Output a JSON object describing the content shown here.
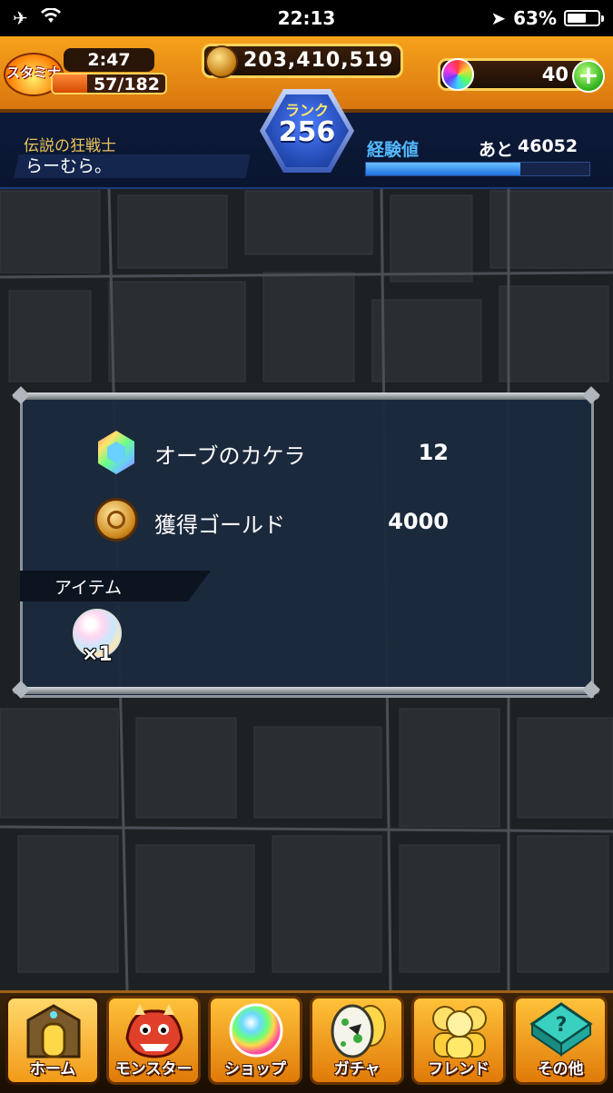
{
  "status_bar": {
    "time": "22:13",
    "battery_percent": "63%",
    "battery_level": 0.63,
    "icons": [
      "airplane-icon",
      "wifi-icon",
      "location-arrow-icon",
      "battery-icon"
    ]
  },
  "hud": {
    "stamina_label": "スタミナ",
    "stamina_timer": "2:47",
    "stamina_current": "57/182",
    "stamina_fraction": 0.31,
    "gold": "203,410,519",
    "orbs": "40",
    "rank_label": "ランク",
    "rank": "256",
    "player_title": "伝説の狂戦士",
    "player_name": "らーむら。",
    "exp_label": "経験値",
    "exp_remaining_prefix": "あと",
    "exp_remaining": "46052",
    "exp_fraction": 0.69
  },
  "result_dialog": {
    "rows": [
      {
        "icon": "orb-fragment-icon",
        "label": "オーブのカケラ",
        "value": "12"
      },
      {
        "icon": "gold-coin-icon",
        "label": "獲得ゴールド",
        "value": "4000"
      }
    ],
    "items_header": "アイテム",
    "items": [
      {
        "icon": "rainbow-orb-item-icon",
        "count": "×1"
      }
    ]
  },
  "bottom_nav": [
    {
      "id": "home",
      "label": "ホーム",
      "icon": "home-gate-icon",
      "active": true
    },
    {
      "id": "monster",
      "label": "モンスター",
      "icon": "monster-dragon-icon",
      "active": false
    },
    {
      "id": "shop",
      "label": "ショップ",
      "icon": "rainbow-orb-icon",
      "active": false
    },
    {
      "id": "gacha",
      "label": "ガチャ",
      "icon": "gacha-egg-icon",
      "active": false
    },
    {
      "id": "friend",
      "label": "フレンド",
      "icon": "friends-icon",
      "active": false
    },
    {
      "id": "other",
      "label": "その他",
      "icon": "question-block-icon",
      "active": false
    }
  ],
  "colors": {
    "hud_orange": "#f7a21c",
    "exp_blue": "#54b8ff",
    "title_gold": "#e9c35a",
    "dialog_bg": "#1b2a3e"
  }
}
